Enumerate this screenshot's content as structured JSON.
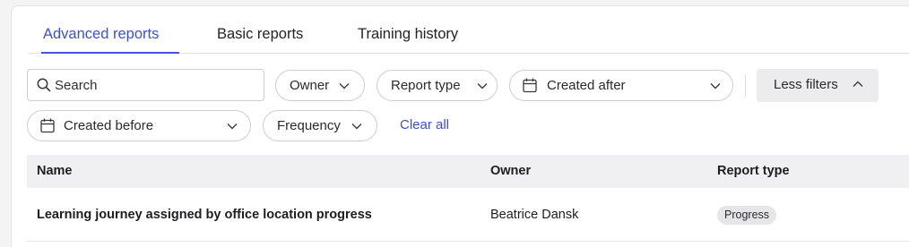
{
  "tabs": [
    {
      "label": "Advanced reports",
      "active": true
    },
    {
      "label": "Basic reports",
      "active": false
    },
    {
      "label": "Training history",
      "active": false
    }
  ],
  "filters": {
    "search_placeholder": "Search",
    "owner_label": "Owner",
    "report_type_label": "Report type",
    "created_after_label": "Created after",
    "less_filters_label": "Less filters",
    "created_before_label": "Created before",
    "frequency_label": "Frequency",
    "clear_all_label": "Clear all"
  },
  "table": {
    "columns": [
      "Name",
      "Owner",
      "Report type"
    ],
    "rows": [
      {
        "name": "Learning journey assigned by office location progress",
        "owner": "Beatrice Dansk",
        "report_type": "Progress"
      }
    ]
  },
  "colors": {
    "accent": "#3d4fd6",
    "header_bg": "#f0f0f2",
    "badge_bg": "#e6e6e9"
  }
}
